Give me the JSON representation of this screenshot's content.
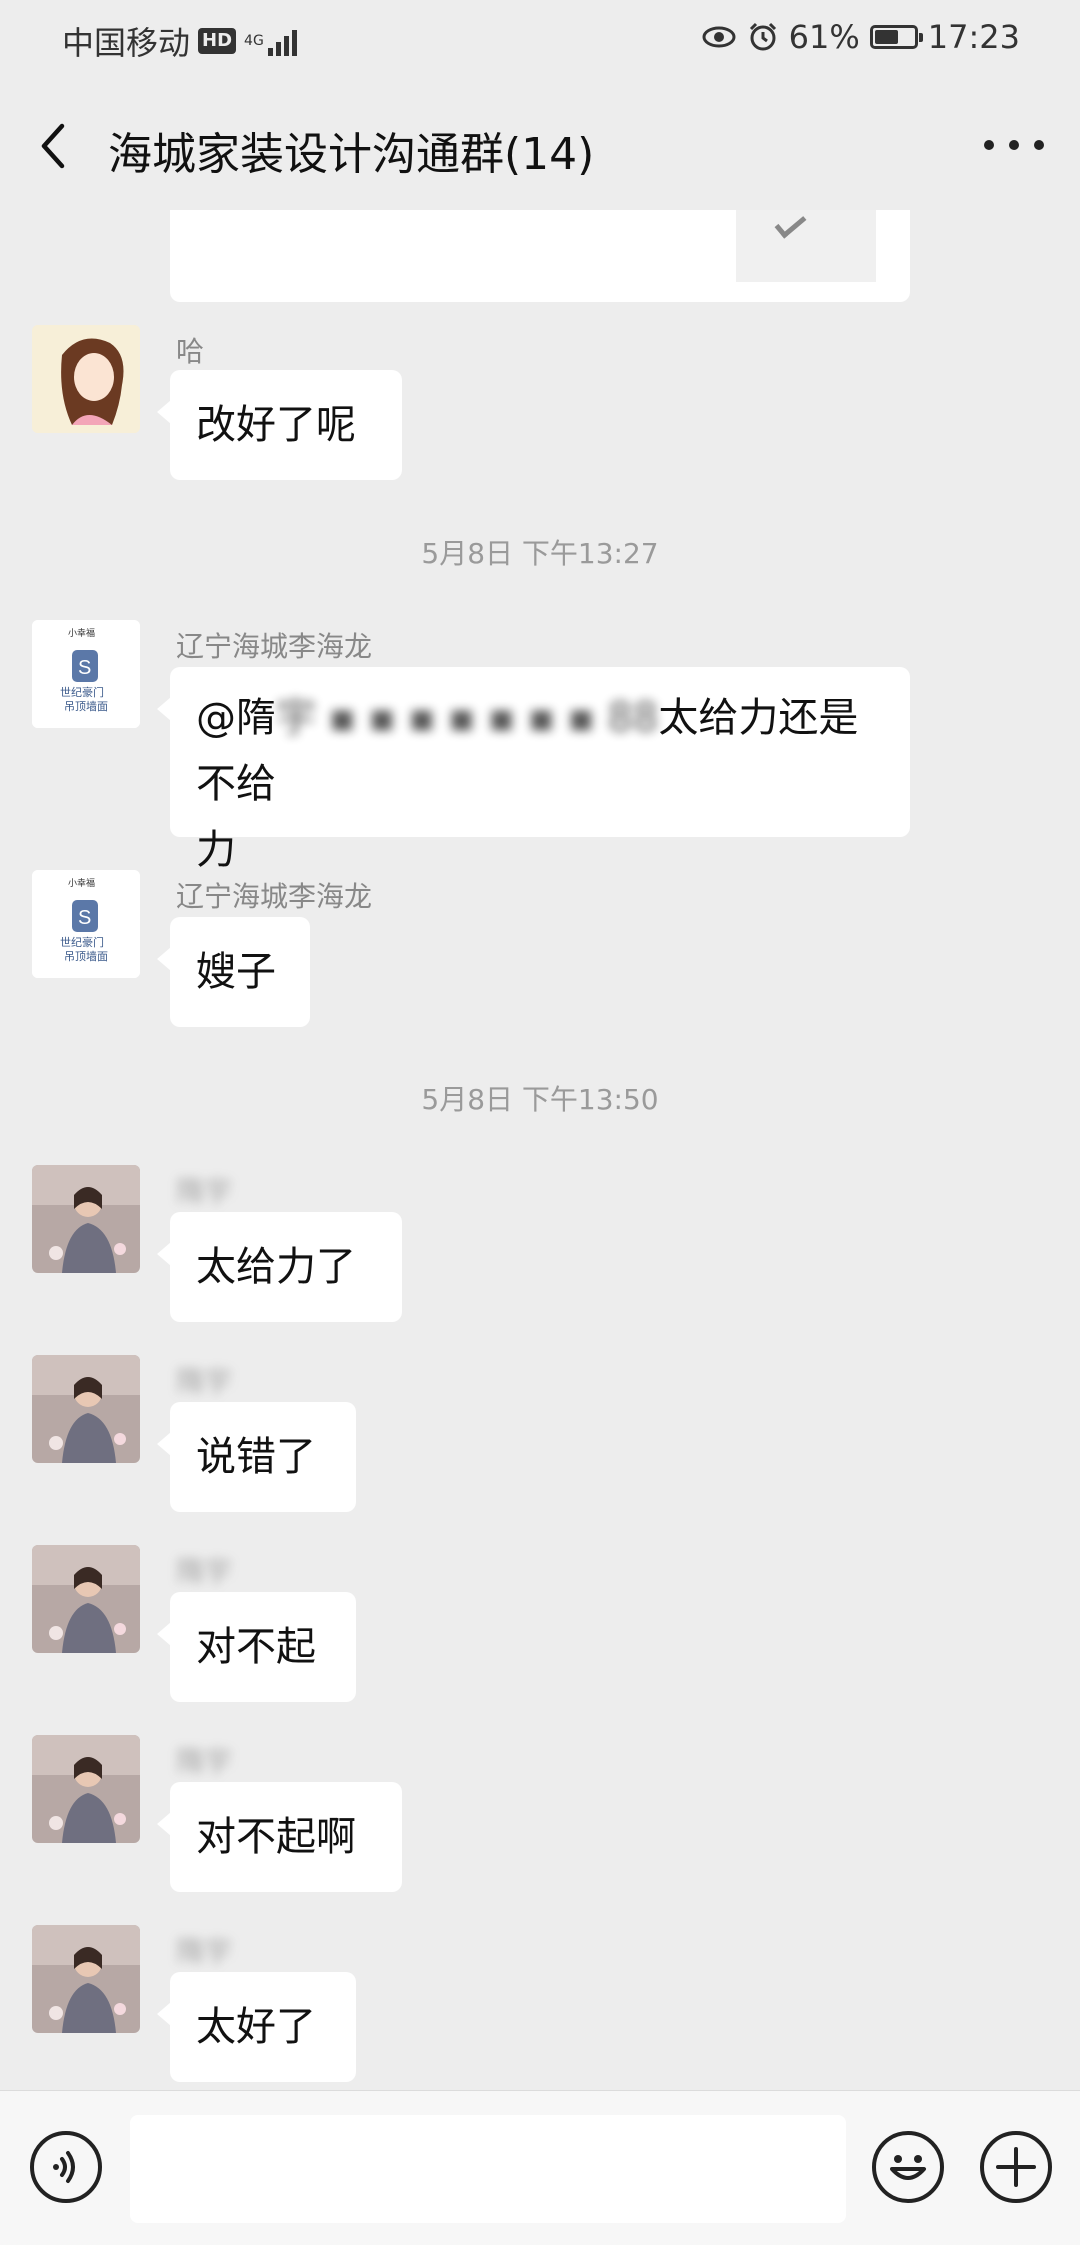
{
  "status_bar": {
    "carrier": "中国移动",
    "hd": "HD",
    "network": "4G",
    "battery": "61%",
    "battery_level": 0.61,
    "time": "17:23"
  },
  "header": {
    "title": "海城家装设计沟通群(14)"
  },
  "messages": [
    {
      "sender": "哈",
      "text": "改好了呢"
    },
    {
      "type": "time",
      "text": "5月8日 下午13:27"
    },
    {
      "sender": "辽宁海城李海龙",
      "text_prefix": "@隋",
      "text_blur": "宇 ▪ ▪ ▪ ▪ ▪ ▪ ▪ 88",
      "text_after": "太给力还是不给",
      "text_line2": "力"
    },
    {
      "sender": "辽宁海城李海龙",
      "text": "嫂子"
    },
    {
      "type": "time",
      "text": "5月8日 下午13:50"
    },
    {
      "sender": "隋宇",
      "text": "太给力了"
    },
    {
      "sender": "隋宇",
      "text": "说错了"
    },
    {
      "sender": "隋宇",
      "text": "对不起"
    },
    {
      "sender": "隋宇",
      "text": "对不起啊"
    },
    {
      "sender": "隋宇",
      "text": "太好了"
    }
  ],
  "avatars": {
    "brand_top": "小幸福",
    "brand_mid": "世纪豪门",
    "brand_bottom": "吊顶墙面"
  },
  "colors": {
    "background": "#ededed",
    "bubble": "#ffffff",
    "muted": "#888888"
  }
}
